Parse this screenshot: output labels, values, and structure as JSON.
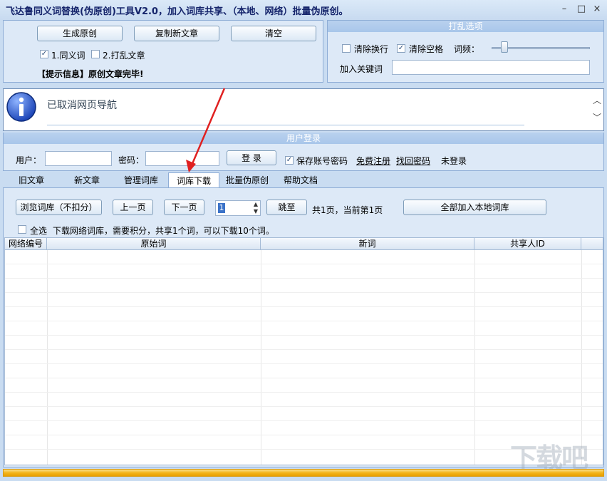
{
  "window": {
    "title": "飞达鲁同义词替换(伪原创)工具V2.0，加入词库共享、（本地、网络）批量伪原创。",
    "min": "–",
    "max": "□",
    "close": "×"
  },
  "top": {
    "generate_label": "生成原创",
    "copy_label": "复制新文章",
    "clear_label": "清空",
    "option1_label": "1.同义词",
    "option2_label": "2.打乱文章",
    "hint_label": "【提示信息】原创文章完毕!",
    "shuffle_title": "打乱选项",
    "remove_newline_label": "清除换行",
    "remove_space_label": "清除空格",
    "freq_label": "词频：",
    "keyword_label": "加入关键词",
    "keyword_value": ""
  },
  "info": {
    "message": "已取消网页导航"
  },
  "login": {
    "title": "用户登录",
    "user_label": "用户：",
    "password_label": "密码：",
    "login_label": "登 录",
    "save_label": "保存账号密码",
    "register_label": "免费注册",
    "recover_label": "找回密码",
    "status": "未登录"
  },
  "tabs": [
    {
      "label": "旧文章"
    },
    {
      "label": "新文章"
    },
    {
      "label": "管理词库"
    },
    {
      "label": "词库下载"
    },
    {
      "label": "批量伪原创"
    },
    {
      "label": "帮助文档"
    }
  ],
  "download": {
    "browse_label": "浏览词库（不扣分）",
    "prev_label": "上一页",
    "next_label": "下一页",
    "page_value": "1",
    "jump_label": "跳至",
    "page_info": "共1页，当前第1页",
    "add_all_label": "全部加入本地词库",
    "select_all_label": "全选",
    "notice": "下载网络词库，需要积分，共享1个词，可以下载10个词。"
  },
  "table": {
    "columns": [
      "网络编号",
      "原始词",
      "新词",
      "共享人ID"
    ]
  },
  "watermark": "下载吧",
  "colors": {
    "accent": "#15246b",
    "arrow": "#e02020",
    "progress": "#f3b41b"
  }
}
